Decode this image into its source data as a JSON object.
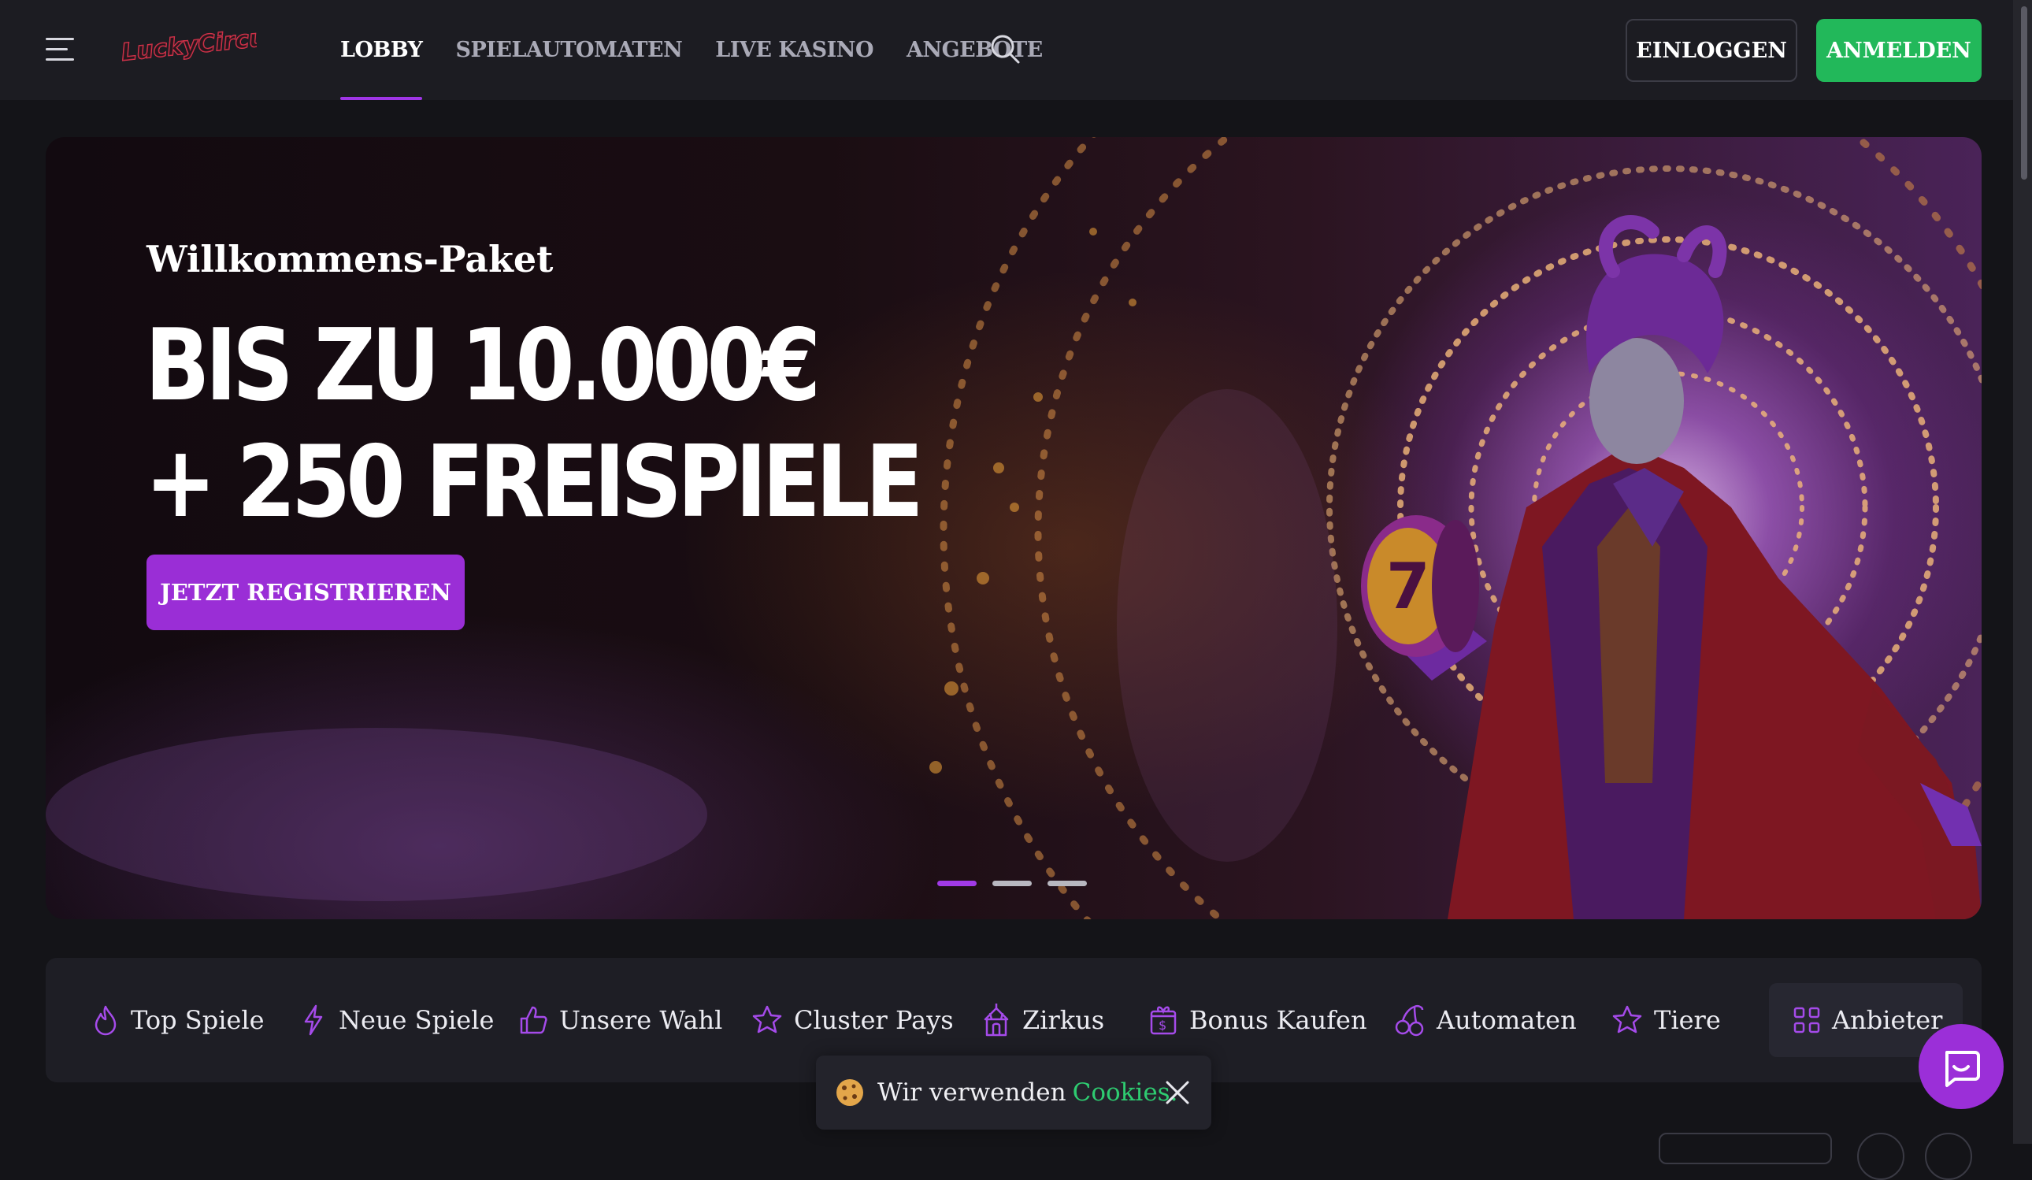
{
  "brand": {
    "logo_text": "LUCKY CIRCUS",
    "accent": "#9f35e6",
    "green": "#22b85a"
  },
  "header": {
    "nav": [
      "LOBBY",
      "SPIELAUTOMATEN",
      "LIVE KASINO",
      "ANGEBOTE"
    ],
    "active_nav": "LOBBY",
    "login_label": "EINLOGGEN",
    "signup_label": "ANMELDEN"
  },
  "hero": {
    "subtitle": "Willkommens-Paket",
    "title_line1": "BIS ZU 10.000€",
    "title_line2": "+ 250 FREISPIELE",
    "cta_label": "JETZT REGISTRIEREN",
    "slides_total": 3,
    "active_slide": 1
  },
  "categories": [
    {
      "label": "Top Spiele",
      "icon": "flame-icon"
    },
    {
      "label": "Neue Spiele",
      "icon": "lightning-icon"
    },
    {
      "label": "Unsere Wahl",
      "icon": "thumbs-up-icon"
    },
    {
      "label": "Cluster Pays",
      "icon": "star-icon"
    },
    {
      "label": "Zirkus",
      "icon": "circus-tent-icon"
    },
    {
      "label": "Bonus Kaufen",
      "icon": "gift-dollar-icon"
    },
    {
      "label": "Automaten",
      "icon": "cherries-icon"
    },
    {
      "label": "Tiere",
      "icon": "star-outline-icon"
    },
    {
      "label": "Anbieter",
      "icon": "grid-icon"
    }
  ],
  "cookie": {
    "text": "Wir verwenden",
    "link": "Cookies."
  }
}
